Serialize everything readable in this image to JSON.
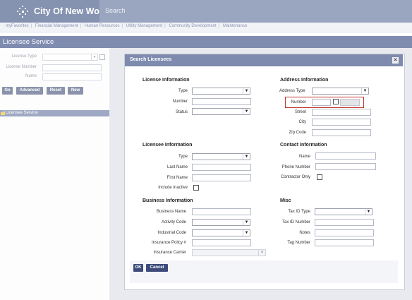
{
  "header": {
    "app_title": "City Of New World",
    "search_label": "Search"
  },
  "nav": {
    "items": [
      "myFavorites",
      "Financial Management",
      "Human Resources",
      "Utility Management",
      "Community Development",
      "Maintenance"
    ]
  },
  "section": {
    "title": "Licensee Service"
  },
  "left_panel": {
    "license_type_label": "License Type",
    "license_number_label": "License Number",
    "name_label": "Name",
    "buttons": {
      "go": "Go",
      "advanced": "Advanced",
      "reset": "Reset",
      "new": "New"
    },
    "tree_label": "Licensee Service"
  },
  "dialog": {
    "title": "Search Licensees",
    "license_info": {
      "title": "License Information",
      "type": "Type",
      "number": "Number",
      "status": "Status"
    },
    "address_info": {
      "title": "Address Information",
      "address_type": "Address Type",
      "number": "Number",
      "street": "Street",
      "city": "City",
      "zip": "Zip Code"
    },
    "licensee_info": {
      "title": "Licensee Information",
      "type": "Type",
      "last_name": "Last Name",
      "first_name": "First Name",
      "include_inactive": "Include Inactive"
    },
    "contact_info": {
      "title": "Contact Information",
      "name": "Name",
      "phone": "Phone Number",
      "contractor_only": "Contractor Only"
    },
    "business_info": {
      "title": "Business Information",
      "business_name": "Business Name",
      "activity_code": "Activity Code",
      "industrial_code": "Industrial Code",
      "insurance_policy": "Insurance Policy #",
      "insurance_carrier": "Insurance Carrier"
    },
    "misc": {
      "title": "Misc",
      "tax_id_type": "Tax ID Type",
      "tax_id_number": "Tax ID Number",
      "notes": "Notes",
      "tag_number": "Tag Number"
    },
    "buttons": {
      "ok": "OK",
      "cancel": "Cancel"
    }
  },
  "colors": {
    "header": "#8592b0",
    "titlebar": "#7e8bae",
    "highlight": "#c0362c",
    "button": "#3c4a7a"
  }
}
